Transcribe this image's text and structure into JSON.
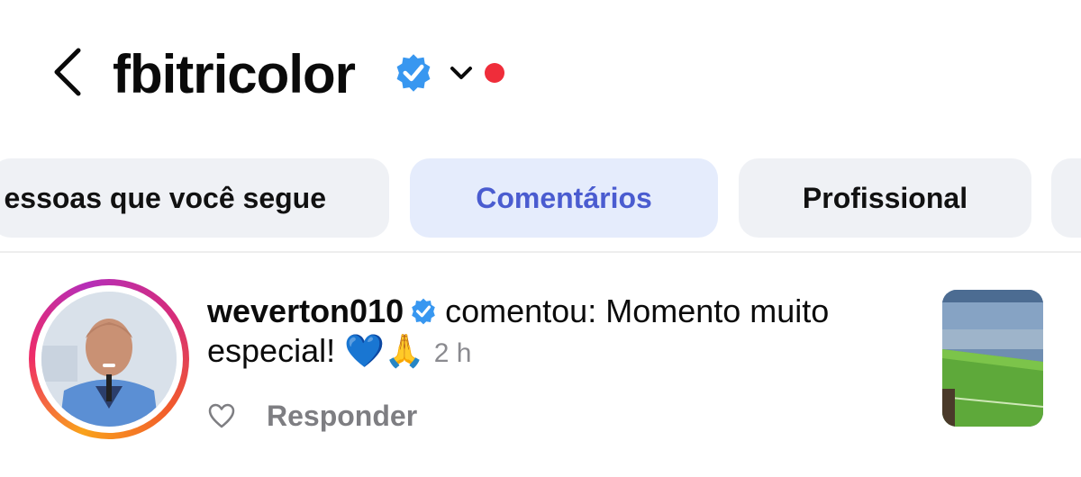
{
  "header": {
    "title": "fbitricolor",
    "verified_color": "#3897f0",
    "notification_dot_color": "#ef2d3a"
  },
  "filters": [
    {
      "label": "essoas que você segue",
      "active": false
    },
    {
      "label": "Comentários",
      "active": true
    },
    {
      "label": "Profissional",
      "active": false
    },
    {
      "label": "",
      "active": false
    }
  ],
  "comment": {
    "username": "weverton010",
    "verified": true,
    "text": "comentou: Momento muito especial!",
    "emojis": "💙🙏",
    "time": "2 h",
    "reply_label": "Responder",
    "avatar_ring_colors": [
      "#f9a21b",
      "#ee2b68",
      "#b52eb8"
    ]
  },
  "accent_color": "#4a5cd0"
}
